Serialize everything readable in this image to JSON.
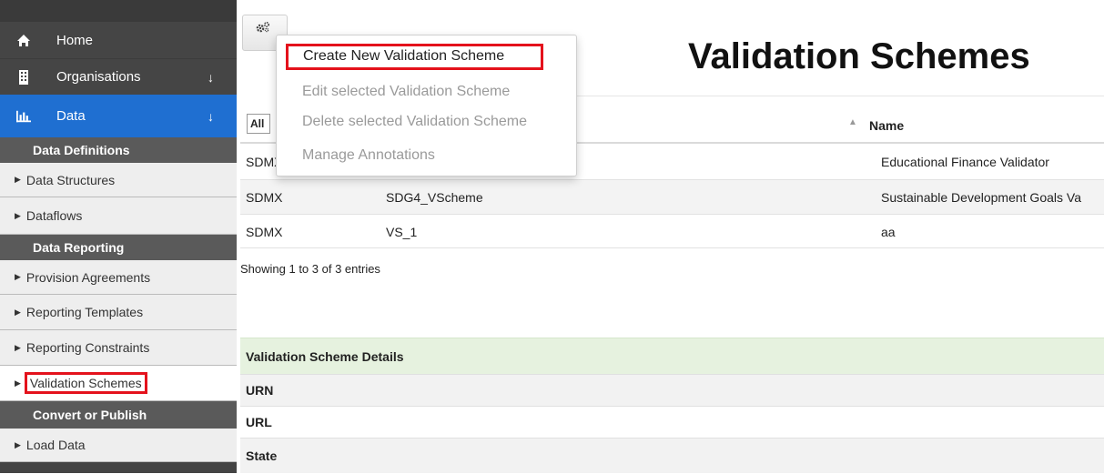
{
  "sidebar": {
    "nav": [
      {
        "label": "Home",
        "icon": "home-icon"
      },
      {
        "label": "Organisations",
        "icon": "building-icon"
      },
      {
        "label": "Data",
        "icon": "bar-chart-icon"
      }
    ],
    "sections": {
      "data_definitions": "Data Definitions",
      "data_reporting": "Data Reporting",
      "convert_publish": "Convert or Publish"
    },
    "items": {
      "data_structures": "Data Structures",
      "dataflows": "Dataflows",
      "provision_agreements": "Provision Agreements",
      "reporting_templates": "Reporting Templates",
      "reporting_constraints": "Reporting Constraints",
      "validation_schemes": "Validation Schemes",
      "load_data": "Load Data"
    }
  },
  "main": {
    "title": "Validation Schemes",
    "filter": "All",
    "column_name": "Name",
    "rows": [
      {
        "agency": "SDMX",
        "id": "",
        "name": "Educational Finance Validator"
      },
      {
        "agency": "SDMX",
        "id": "SDG4_VScheme",
        "name": "Sustainable Development Goals Va"
      },
      {
        "agency": "SDMX",
        "id": "VS_1",
        "name": "aa"
      }
    ],
    "entries_info": "Showing 1 to 3 of 3 entries",
    "details": {
      "header": "Validation Scheme Details",
      "urn": "URN",
      "url": "URL",
      "state": "State"
    }
  },
  "menu": {
    "create": "Create New Validation Scheme",
    "edit": "Edit selected Validation Scheme",
    "delete": "Delete selected Validation Scheme",
    "annotations": "Manage Annotations"
  },
  "colors": {
    "sidebar_bg": "#454545",
    "active_nav": "#1f6fd1",
    "highlight": "#e4121c",
    "details_header_bg": "#e6f2df"
  }
}
